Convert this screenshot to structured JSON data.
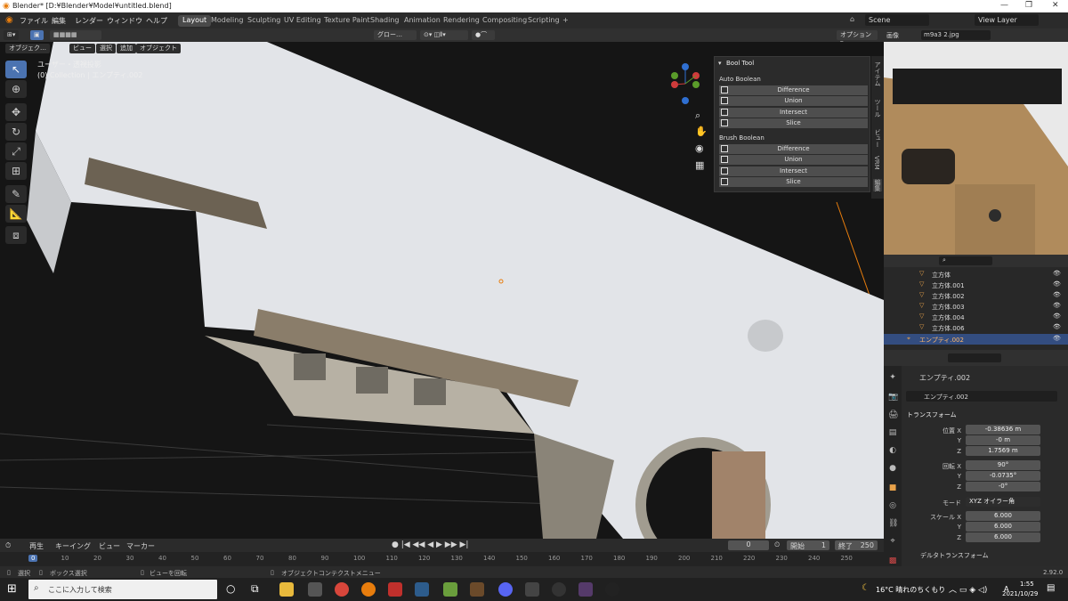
{
  "window": {
    "title": "Blender* [D:¥Blender¥Model¥untitled.blend]"
  },
  "menu": [
    "ファイル",
    "編集",
    "レンダー",
    "ウィンドウ",
    "ヘルプ"
  ],
  "workspaces": [
    "Layout",
    "Modeling",
    "Sculpting",
    "UV Editing",
    "Texture Paint",
    "Shading",
    "Animation",
    "Rendering",
    "Compositing",
    "Scripting",
    "+"
  ],
  "scene": {
    "label": "Scene",
    "view_layer": "View Layer"
  },
  "viewport_header": {
    "mode": "オブジェク…",
    "view": "ビュー",
    "select": "選択",
    "add": "追加",
    "object": "オブジェクト",
    "orientation": "グロー…",
    "options": "オプション"
  },
  "viewport_overlay": {
    "view_name": "ユーザー・透視投影",
    "collection": "(0) Collection | エンプティ.002"
  },
  "bool_tool": {
    "title": "Bool Tool",
    "auto_section": "Auto Boolean",
    "brush_section": "Brush Boolean",
    "auto_buttons": [
      "Difference",
      "Union",
      "Intersect",
      "Slice"
    ],
    "brush_buttons": [
      "Difference",
      "Union",
      "Intersect",
      "Slice"
    ]
  },
  "n_tabs": [
    "アイテム",
    "ツール",
    "ビュー",
    "VRM",
    "編集"
  ],
  "image_editor": {
    "label": "画像",
    "file": "m9a3 2.jpg"
  },
  "outliner": {
    "items": [
      "立方体",
      "立方体.001",
      "立方体.002",
      "立方体.003",
      "立方体.004",
      "立方体.006",
      "エンプティ.002"
    ],
    "selected": "エンプティ.002"
  },
  "properties": {
    "object_name": "エンプティ.002",
    "data_name": "エンプティ.002",
    "transform_header": "トランスフォーム",
    "location_label": "位置 X",
    "location": [
      "-0.38636 m",
      "-0 m",
      "1.7569 m"
    ],
    "rotation_label": "回転 X",
    "rotation": [
      "90°",
      "-0.0735°",
      "-0°"
    ],
    "mode_label": "モード",
    "mode": "XYZ オイラー角",
    "scale_label": "スケール X",
    "scale": [
      "6.000",
      "6.000",
      "6.000"
    ],
    "axis_y": "Y",
    "axis_z": "Z",
    "delta": "デルタトランスフォーム",
    "version": "2.92.0"
  },
  "timeline": {
    "playback": "再生",
    "keying": "キーイング",
    "view": "ビュー",
    "marker": "マーカー",
    "current_frame": "0",
    "start_label": "開始",
    "start": "1",
    "end_label": "終了",
    "end": "250",
    "ticks": [
      "0",
      "10",
      "20",
      "30",
      "40",
      "50",
      "60",
      "70",
      "80",
      "90",
      "100",
      "110",
      "120",
      "130",
      "140",
      "150",
      "160",
      "170",
      "180",
      "190",
      "200",
      "210",
      "220",
      "230",
      "240",
      "250"
    ]
  },
  "statusbar": {
    "select": "選択",
    "box_select": "ボックス選択",
    "rotate_view": "ビューを回転",
    "context_menu": "オブジェクトコンテクストメニュー"
  },
  "taskbar": {
    "search_placeholder": "ここに入力して検索",
    "weather": "16°C 晴れのちくもり",
    "ime": "A",
    "time": "1:55",
    "date": "2021/10/29"
  },
  "colors": {
    "accent": "#4b73b1",
    "selected_row": "#334d80",
    "model": "#e4e6ea",
    "metal": "#8a8478"
  }
}
